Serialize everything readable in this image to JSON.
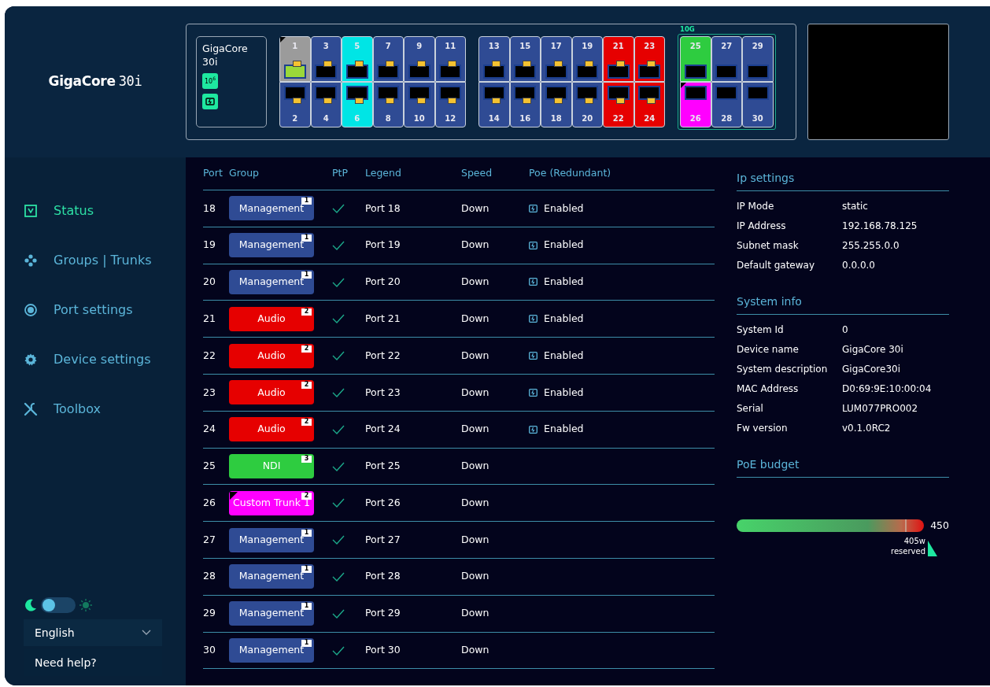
{
  "logo": {
    "brand": "GigaCore",
    "model": "30i"
  },
  "device": {
    "name": "GigaCore",
    "model": "30i",
    "badges": [
      {
        "kind": "speed",
        "text": "10$^{6}$"
      },
      {
        "kind": "poe"
      }
    ]
  },
  "port_blocks": [
    {
      "kind": "rj45",
      "ports": [
        {
          "label": "1",
          "color": "#9b9b9b",
          "link": true,
          "trunk_mark": true
        },
        {
          "label": "2",
          "color": "#2f4b94",
          "link": false,
          "trunk_mark": false
        },
        {
          "label": "3",
          "color": "#2f4b94",
          "link": false,
          "trunk_mark": false
        },
        {
          "label": "4",
          "color": "#2f4b94",
          "link": false,
          "trunk_mark": false
        },
        {
          "label": "5",
          "color": "#00e5e5",
          "link": false,
          "trunk_mark": false
        },
        {
          "label": "6",
          "color": "#00e5e5",
          "link": false,
          "trunk_mark": false
        },
        {
          "label": "7",
          "color": "#2f4b94",
          "link": false,
          "trunk_mark": false
        },
        {
          "label": "8",
          "color": "#2f4b94",
          "link": false,
          "trunk_mark": false
        },
        {
          "label": "9",
          "color": "#2f4b94",
          "link": false,
          "trunk_mark": false
        },
        {
          "label": "10",
          "color": "#2f4b94",
          "link": false,
          "trunk_mark": false
        },
        {
          "label": "11",
          "color": "#2f4b94",
          "link": false,
          "trunk_mark": false
        },
        {
          "label": "12",
          "color": "#2f4b94",
          "link": false,
          "trunk_mark": false
        }
      ]
    },
    {
      "kind": "rj45",
      "ports": [
        {
          "label": "13",
          "color": "#2f4b94",
          "link": false,
          "trunk_mark": false
        },
        {
          "label": "14",
          "color": "#2f4b94",
          "link": false,
          "trunk_mark": false
        },
        {
          "label": "15",
          "color": "#2f4b94",
          "link": false,
          "trunk_mark": false
        },
        {
          "label": "16",
          "color": "#2f4b94",
          "link": false,
          "trunk_mark": false
        },
        {
          "label": "17",
          "color": "#2f4b94",
          "link": false,
          "trunk_mark": false
        },
        {
          "label": "18",
          "color": "#2f4b94",
          "link": false,
          "trunk_mark": false
        },
        {
          "label": "19",
          "color": "#2f4b94",
          "link": false,
          "trunk_mark": false
        },
        {
          "label": "20",
          "color": "#2f4b94",
          "link": false,
          "trunk_mark": false
        },
        {
          "label": "21",
          "color": "#e60000",
          "link": false,
          "trunk_mark": false
        },
        {
          "label": "22",
          "color": "#e60000",
          "link": false,
          "trunk_mark": false
        },
        {
          "label": "23",
          "color": "#e60000",
          "link": false,
          "trunk_mark": false
        },
        {
          "label": "24",
          "color": "#e60000",
          "link": false,
          "trunk_mark": false
        }
      ]
    },
    {
      "kind": "sfp",
      "label": "10G",
      "ports": [
        {
          "label": "25",
          "color": "#2ecc40",
          "link": false,
          "trunk_mark": false
        },
        {
          "label": "26",
          "color": "#ff00ff",
          "link": false,
          "trunk_mark": true
        },
        {
          "label": "27",
          "color": "#2f4b94",
          "link": false,
          "trunk_mark": false
        },
        {
          "label": "28",
          "color": "#2f4b94",
          "link": false,
          "trunk_mark": false
        },
        {
          "label": "29",
          "color": "#2f4b94",
          "link": false,
          "trunk_mark": false
        },
        {
          "label": "30",
          "color": "#2f4b94",
          "link": false,
          "trunk_mark": false
        }
      ]
    }
  ],
  "sidebar": {
    "items": [
      {
        "label": "Status",
        "selected": true
      },
      {
        "label": "Groups | Trunks",
        "selected": false
      },
      {
        "label": "Port settings",
        "selected": false
      },
      {
        "label": "Device settings",
        "selected": false
      },
      {
        "label": "Toolbox",
        "selected": false
      }
    ],
    "theme_toggle": {
      "light": false
    },
    "language": "English",
    "help": "Need help?"
  },
  "table": {
    "columns": [
      "Port",
      "Group",
      "PtP",
      "Legend",
      "Speed",
      "Poe (Redundant)"
    ],
    "rows": [
      {
        "port": "18",
        "group": {
          "name": "Management",
          "color": "#2f4b94",
          "count": "1",
          "trunk_mark": false
        },
        "ptp": true,
        "legend": "Port 18",
        "speed": "Down",
        "poe": "Enabled"
      },
      {
        "port": "19",
        "group": {
          "name": "Management",
          "color": "#2f4b94",
          "count": "1",
          "trunk_mark": false
        },
        "ptp": true,
        "legend": "Port 19",
        "speed": "Down",
        "poe": "Enabled"
      },
      {
        "port": "20",
        "group": {
          "name": "Management",
          "color": "#2f4b94",
          "count": "1",
          "trunk_mark": false
        },
        "ptp": true,
        "legend": "Port 20",
        "speed": "Down",
        "poe": "Enabled"
      },
      {
        "port": "21",
        "group": {
          "name": "Audio",
          "color": "#e60000",
          "count": "2",
          "trunk_mark": false
        },
        "ptp": true,
        "legend": "Port 21",
        "speed": "Down",
        "poe": "Enabled"
      },
      {
        "port": "22",
        "group": {
          "name": "Audio",
          "color": "#e60000",
          "count": "2",
          "trunk_mark": false
        },
        "ptp": true,
        "legend": "Port 22",
        "speed": "Down",
        "poe": "Enabled"
      },
      {
        "port": "23",
        "group": {
          "name": "Audio",
          "color": "#e60000",
          "count": "2",
          "trunk_mark": false
        },
        "ptp": true,
        "legend": "Port 23",
        "speed": "Down",
        "poe": "Enabled"
      },
      {
        "port": "24",
        "group": {
          "name": "Audio",
          "color": "#e60000",
          "count": "2",
          "trunk_mark": false
        },
        "ptp": true,
        "legend": "Port 24",
        "speed": "Down",
        "poe": "Enabled"
      },
      {
        "port": "25",
        "group": {
          "name": "NDI",
          "color": "#2ecc40",
          "count": "3",
          "trunk_mark": false
        },
        "ptp": true,
        "legend": "Port 25",
        "speed": "Down"
      },
      {
        "port": "26",
        "group": {
          "name": "Custom Trunk 1",
          "color": "#ff00ff",
          "count": "2",
          "trunk_mark": true
        },
        "ptp": true,
        "legend": "Port 26",
        "speed": "Down"
      },
      {
        "port": "27",
        "group": {
          "name": "Management",
          "color": "#2f4b94",
          "count": "1",
          "trunk_mark": false
        },
        "ptp": true,
        "legend": "Port 27",
        "speed": "Down"
      },
      {
        "port": "28",
        "group": {
          "name": "Management",
          "color": "#2f4b94",
          "count": "1",
          "trunk_mark": false
        },
        "ptp": true,
        "legend": "Port 28",
        "speed": "Down"
      },
      {
        "port": "29",
        "group": {
          "name": "Management",
          "color": "#2f4b94",
          "count": "1",
          "trunk_mark": false
        },
        "ptp": true,
        "legend": "Port 29",
        "speed": "Down"
      },
      {
        "port": "30",
        "group": {
          "name": "Management",
          "color": "#2f4b94",
          "count": "1",
          "trunk_mark": false
        },
        "ptp": true,
        "legend": "Port 30",
        "speed": "Down"
      }
    ]
  },
  "info_sections": [
    {
      "title": "Ip settings",
      "rows": [
        {
          "label": "IP Mode",
          "value": "static"
        },
        {
          "label": "IP Address",
          "value": "192.168.78.125"
        },
        {
          "label": "Subnet mask",
          "value": "255.255.0.0"
        },
        {
          "label": "Default gateway",
          "value": "0.0.0.0"
        }
      ]
    },
    {
      "title": "System info",
      "rows": [
        {
          "label": "System Id",
          "value": "0"
        },
        {
          "label": "Device name",
          "value": "GigaCore 30i"
        },
        {
          "label": "System description",
          "value": "GigaCore30i"
        },
        {
          "label": "MAC Address",
          "value": "D0:69:9E:10:00:04"
        },
        {
          "label": "Serial",
          "value": "LUM077PRO002"
        },
        {
          "label": "Fw version",
          "value": "v0.1.0RC2"
        }
      ]
    }
  ],
  "poe_budget": {
    "title": "PoE budget",
    "max": "450",
    "level": 0.9,
    "reserved_value": "405w",
    "reserved_label": "reserved"
  }
}
